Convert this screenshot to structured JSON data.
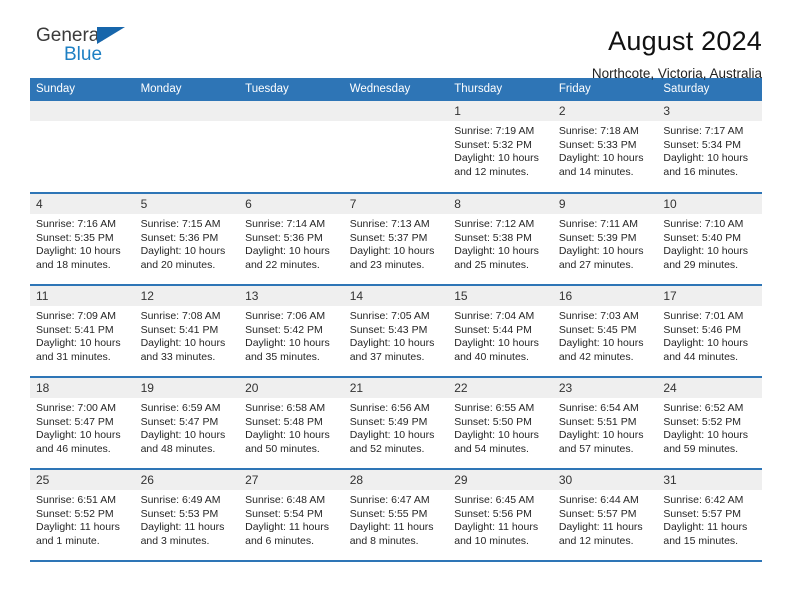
{
  "brand": {
    "name_top": "General",
    "name_bottom": "Blue",
    "mark": "triangle-logo-mark",
    "color_top": "#3b3b3b",
    "color_bottom": "#1d7fc3",
    "color_mark": "#1766ab"
  },
  "header": {
    "title": "August 2024",
    "location": "Northcote, Victoria, Australia"
  },
  "theme": {
    "header_bg": "#2e75b6",
    "header_text": "#ffffff",
    "daynum_bg": "#efefef",
    "row_rule": "#2e75b6"
  },
  "weekdays": [
    "Sunday",
    "Monday",
    "Tuesday",
    "Wednesday",
    "Thursday",
    "Friday",
    "Saturday"
  ],
  "weeks": [
    [
      {
        "day": "",
        "sunrise": "",
        "sunset": "",
        "daylight1": "",
        "daylight2": ""
      },
      {
        "day": "",
        "sunrise": "",
        "sunset": "",
        "daylight1": "",
        "daylight2": ""
      },
      {
        "day": "",
        "sunrise": "",
        "sunset": "",
        "daylight1": "",
        "daylight2": ""
      },
      {
        "day": "",
        "sunrise": "",
        "sunset": "",
        "daylight1": "",
        "daylight2": ""
      },
      {
        "day": "1",
        "sunrise": "Sunrise: 7:19 AM",
        "sunset": "Sunset: 5:32 PM",
        "daylight1": "Daylight: 10 hours",
        "daylight2": "and 12 minutes."
      },
      {
        "day": "2",
        "sunrise": "Sunrise: 7:18 AM",
        "sunset": "Sunset: 5:33 PM",
        "daylight1": "Daylight: 10 hours",
        "daylight2": "and 14 minutes."
      },
      {
        "day": "3",
        "sunrise": "Sunrise: 7:17 AM",
        "sunset": "Sunset: 5:34 PM",
        "daylight1": "Daylight: 10 hours",
        "daylight2": "and 16 minutes."
      }
    ],
    [
      {
        "day": "4",
        "sunrise": "Sunrise: 7:16 AM",
        "sunset": "Sunset: 5:35 PM",
        "daylight1": "Daylight: 10 hours",
        "daylight2": "and 18 minutes."
      },
      {
        "day": "5",
        "sunrise": "Sunrise: 7:15 AM",
        "sunset": "Sunset: 5:36 PM",
        "daylight1": "Daylight: 10 hours",
        "daylight2": "and 20 minutes."
      },
      {
        "day": "6",
        "sunrise": "Sunrise: 7:14 AM",
        "sunset": "Sunset: 5:36 PM",
        "daylight1": "Daylight: 10 hours",
        "daylight2": "and 22 minutes."
      },
      {
        "day": "7",
        "sunrise": "Sunrise: 7:13 AM",
        "sunset": "Sunset: 5:37 PM",
        "daylight1": "Daylight: 10 hours",
        "daylight2": "and 23 minutes."
      },
      {
        "day": "8",
        "sunrise": "Sunrise: 7:12 AM",
        "sunset": "Sunset: 5:38 PM",
        "daylight1": "Daylight: 10 hours",
        "daylight2": "and 25 minutes."
      },
      {
        "day": "9",
        "sunrise": "Sunrise: 7:11 AM",
        "sunset": "Sunset: 5:39 PM",
        "daylight1": "Daylight: 10 hours",
        "daylight2": "and 27 minutes."
      },
      {
        "day": "10",
        "sunrise": "Sunrise: 7:10 AM",
        "sunset": "Sunset: 5:40 PM",
        "daylight1": "Daylight: 10 hours",
        "daylight2": "and 29 minutes."
      }
    ],
    [
      {
        "day": "11",
        "sunrise": "Sunrise: 7:09 AM",
        "sunset": "Sunset: 5:41 PM",
        "daylight1": "Daylight: 10 hours",
        "daylight2": "and 31 minutes."
      },
      {
        "day": "12",
        "sunrise": "Sunrise: 7:08 AM",
        "sunset": "Sunset: 5:41 PM",
        "daylight1": "Daylight: 10 hours",
        "daylight2": "and 33 minutes."
      },
      {
        "day": "13",
        "sunrise": "Sunrise: 7:06 AM",
        "sunset": "Sunset: 5:42 PM",
        "daylight1": "Daylight: 10 hours",
        "daylight2": "and 35 minutes."
      },
      {
        "day": "14",
        "sunrise": "Sunrise: 7:05 AM",
        "sunset": "Sunset: 5:43 PM",
        "daylight1": "Daylight: 10 hours",
        "daylight2": "and 37 minutes."
      },
      {
        "day": "15",
        "sunrise": "Sunrise: 7:04 AM",
        "sunset": "Sunset: 5:44 PM",
        "daylight1": "Daylight: 10 hours",
        "daylight2": "and 40 minutes."
      },
      {
        "day": "16",
        "sunrise": "Sunrise: 7:03 AM",
        "sunset": "Sunset: 5:45 PM",
        "daylight1": "Daylight: 10 hours",
        "daylight2": "and 42 minutes."
      },
      {
        "day": "17",
        "sunrise": "Sunrise: 7:01 AM",
        "sunset": "Sunset: 5:46 PM",
        "daylight1": "Daylight: 10 hours",
        "daylight2": "and 44 minutes."
      }
    ],
    [
      {
        "day": "18",
        "sunrise": "Sunrise: 7:00 AM",
        "sunset": "Sunset: 5:47 PM",
        "daylight1": "Daylight: 10 hours",
        "daylight2": "and 46 minutes."
      },
      {
        "day": "19",
        "sunrise": "Sunrise: 6:59 AM",
        "sunset": "Sunset: 5:47 PM",
        "daylight1": "Daylight: 10 hours",
        "daylight2": "and 48 minutes."
      },
      {
        "day": "20",
        "sunrise": "Sunrise: 6:58 AM",
        "sunset": "Sunset: 5:48 PM",
        "daylight1": "Daylight: 10 hours",
        "daylight2": "and 50 minutes."
      },
      {
        "day": "21",
        "sunrise": "Sunrise: 6:56 AM",
        "sunset": "Sunset: 5:49 PM",
        "daylight1": "Daylight: 10 hours",
        "daylight2": "and 52 minutes."
      },
      {
        "day": "22",
        "sunrise": "Sunrise: 6:55 AM",
        "sunset": "Sunset: 5:50 PM",
        "daylight1": "Daylight: 10 hours",
        "daylight2": "and 54 minutes."
      },
      {
        "day": "23",
        "sunrise": "Sunrise: 6:54 AM",
        "sunset": "Sunset: 5:51 PM",
        "daylight1": "Daylight: 10 hours",
        "daylight2": "and 57 minutes."
      },
      {
        "day": "24",
        "sunrise": "Sunrise: 6:52 AM",
        "sunset": "Sunset: 5:52 PM",
        "daylight1": "Daylight: 10 hours",
        "daylight2": "and 59 minutes."
      }
    ],
    [
      {
        "day": "25",
        "sunrise": "Sunrise: 6:51 AM",
        "sunset": "Sunset: 5:52 PM",
        "daylight1": "Daylight: 11 hours",
        "daylight2": "and 1 minute."
      },
      {
        "day": "26",
        "sunrise": "Sunrise: 6:49 AM",
        "sunset": "Sunset: 5:53 PM",
        "daylight1": "Daylight: 11 hours",
        "daylight2": "and 3 minutes."
      },
      {
        "day": "27",
        "sunrise": "Sunrise: 6:48 AM",
        "sunset": "Sunset: 5:54 PM",
        "daylight1": "Daylight: 11 hours",
        "daylight2": "and 6 minutes."
      },
      {
        "day": "28",
        "sunrise": "Sunrise: 6:47 AM",
        "sunset": "Sunset: 5:55 PM",
        "daylight1": "Daylight: 11 hours",
        "daylight2": "and 8 minutes."
      },
      {
        "day": "29",
        "sunrise": "Sunrise: 6:45 AM",
        "sunset": "Sunset: 5:56 PM",
        "daylight1": "Daylight: 11 hours",
        "daylight2": "and 10 minutes."
      },
      {
        "day": "30",
        "sunrise": "Sunrise: 6:44 AM",
        "sunset": "Sunset: 5:57 PM",
        "daylight1": "Daylight: 11 hours",
        "daylight2": "and 12 minutes."
      },
      {
        "day": "31",
        "sunrise": "Sunrise: 6:42 AM",
        "sunset": "Sunset: 5:57 PM",
        "daylight1": "Daylight: 11 hours",
        "daylight2": "and 15 minutes."
      }
    ]
  ]
}
